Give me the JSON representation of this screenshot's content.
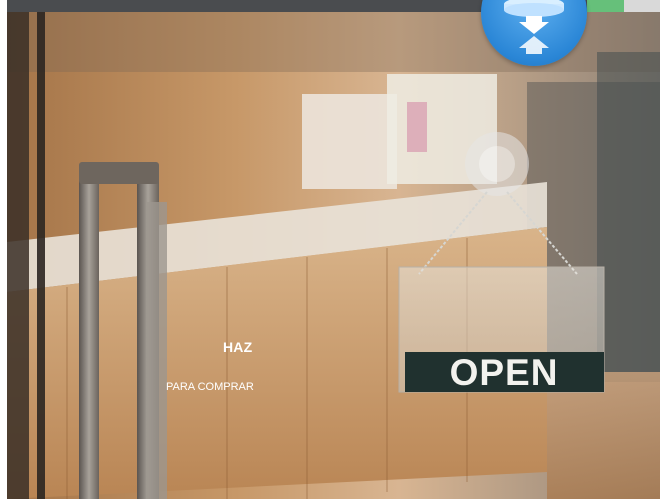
{
  "hero": {
    "title": "HAZ",
    "subtitle": "PARA COMPRAR"
  },
  "sign": {
    "text": "OPEN"
  },
  "badge": {
    "icon": "compress-arrows-icon",
    "color": "#2a86d6"
  },
  "colors": {
    "top_strip": "#4a4c4f",
    "accent_green": "#66c07a",
    "accent_gray": "#d9d9d9"
  }
}
